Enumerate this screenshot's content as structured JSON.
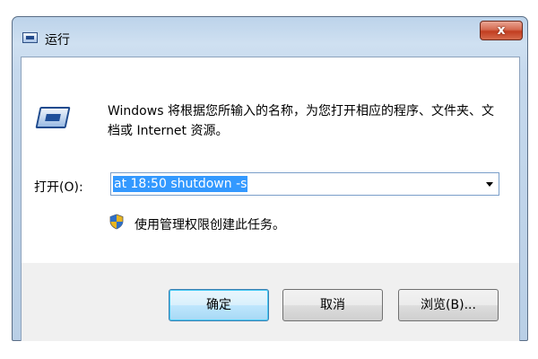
{
  "window": {
    "title": "运行",
    "close_label": "x"
  },
  "dialog": {
    "description": "Windows 将根据您所输入的名称，为您打开相应的程序、文件夹、文档或 Internet 资源。",
    "open_label": "打开(O):",
    "command_value": "at 18:50 shutdown -s",
    "admin_note": "使用管理权限创建此任务。"
  },
  "buttons": {
    "ok": "确定",
    "cancel": "取消",
    "browse": "浏览(B)..."
  },
  "icons": {
    "title": "run-icon",
    "dialog": "run-program-icon",
    "shield": "uac-shield-icon",
    "dropdown": "chevron-down-icon"
  }
}
